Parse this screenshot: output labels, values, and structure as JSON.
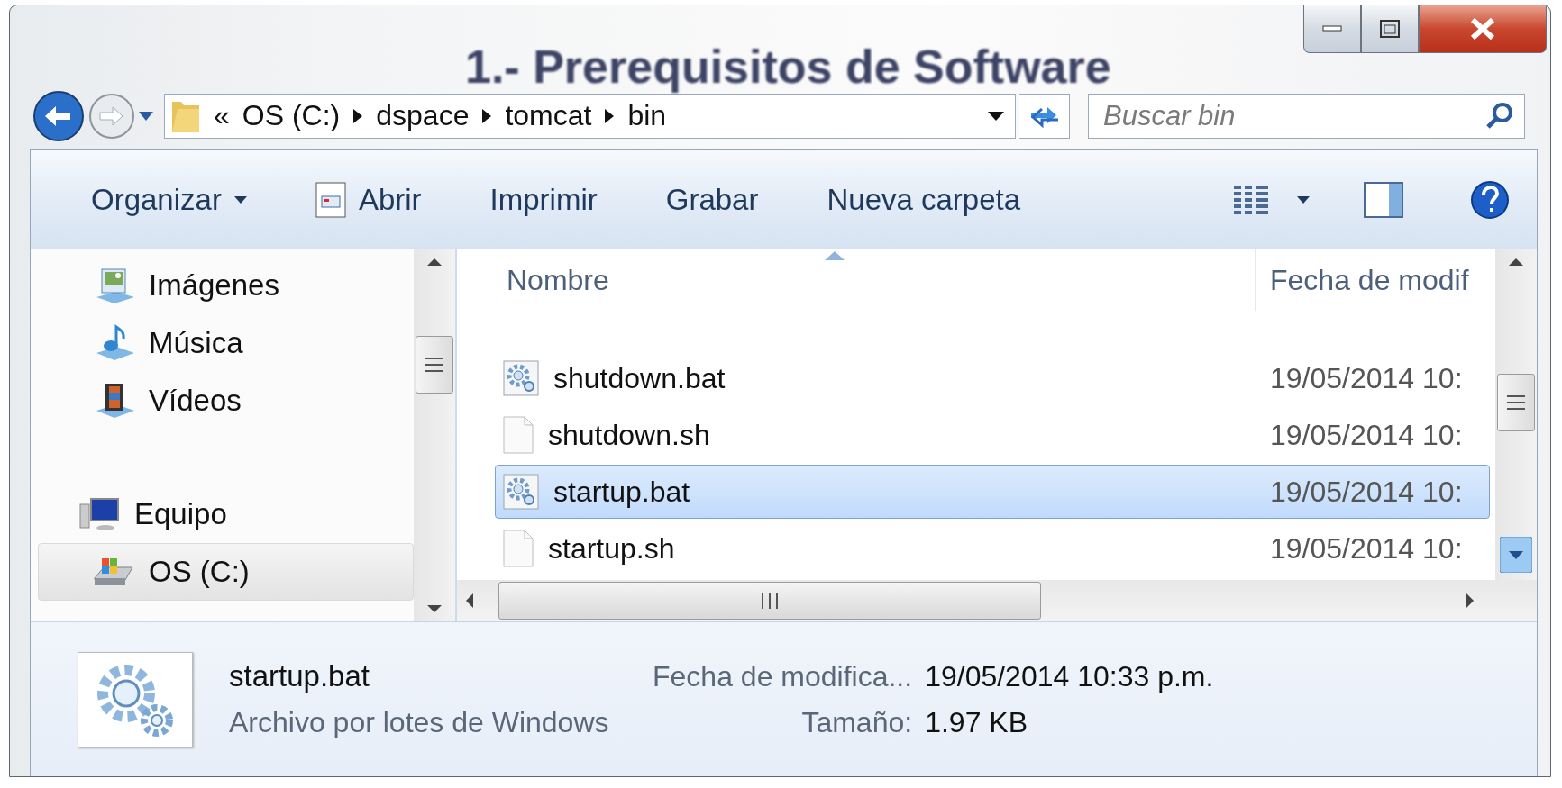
{
  "background_heading": "1.- Prerequisitos de Software",
  "address": {
    "overflow": "«",
    "crumbs": [
      "OS (C:)",
      "dspace",
      "tomcat",
      "bin"
    ]
  },
  "search": {
    "placeholder": "Buscar bin"
  },
  "toolbar": {
    "items": [
      {
        "label": "Organizar",
        "kind": "menu"
      },
      {
        "label": "Abrir",
        "kind": "open"
      },
      {
        "label": "Imprimir",
        "kind": "plain"
      },
      {
        "label": "Grabar",
        "kind": "plain"
      },
      {
        "label": "Nueva carpeta",
        "kind": "plain"
      }
    ]
  },
  "nav": {
    "libraries": [
      {
        "label": "Imágenes",
        "kind": "pictures",
        "selected": false
      },
      {
        "label": "Música",
        "kind": "music",
        "selected": false
      },
      {
        "label": "Vídeos",
        "kind": "videos",
        "selected": false
      }
    ],
    "computer": {
      "label": "Equipo",
      "kind": "computer",
      "selected": false,
      "children": [
        {
          "label": "OS (C:)",
          "kind": "drive",
          "selected": true
        }
      ]
    }
  },
  "files": {
    "columns": [
      "Nombre",
      "Fecha de modif"
    ],
    "rows": [
      {
        "name": "shutdown.bat",
        "kind": "batch",
        "date": "19/05/2014 10:",
        "selected": false
      },
      {
        "name": "shutdown.sh",
        "kind": "text",
        "date": "19/05/2014 10:",
        "selected": false
      },
      {
        "name": "startup.bat",
        "kind": "batch",
        "date": "19/05/2014 10:",
        "selected": true
      },
      {
        "name": "startup.sh",
        "kind": "text",
        "date": "19/05/2014 10:",
        "selected": false
      }
    ]
  },
  "details": {
    "name": "startup.bat",
    "type": "Archivo por lotes de Windows",
    "fields": [
      {
        "label": "Fecha de modifica...",
        "value": "19/05/2014 10:33 p.m."
      },
      {
        "label": "Tamaño:",
        "value": "1.97 KB"
      }
    ]
  }
}
